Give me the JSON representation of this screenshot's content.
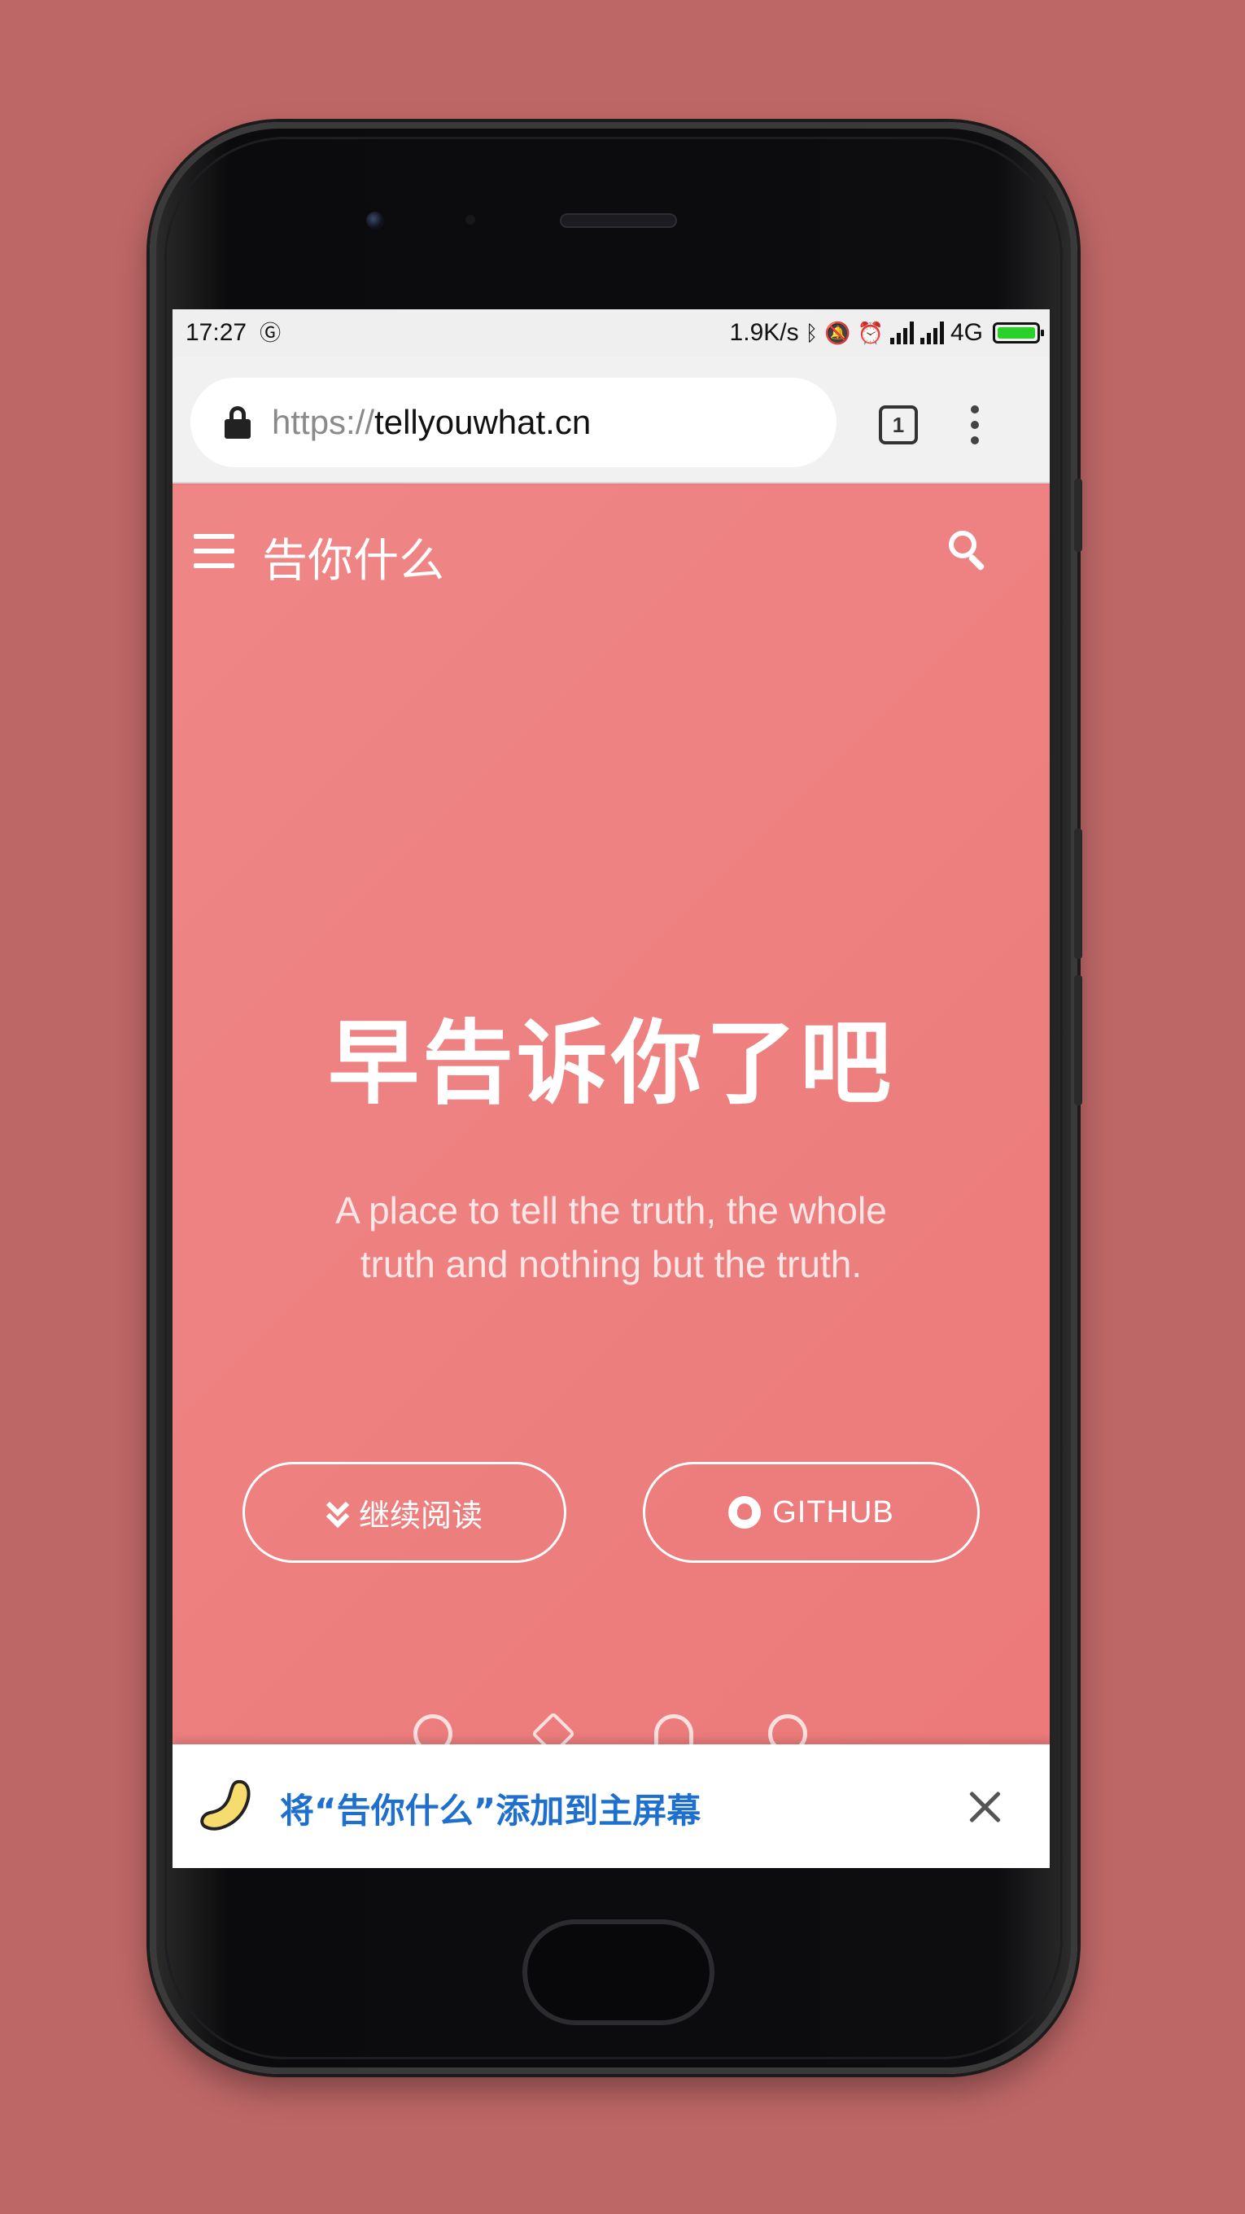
{
  "status_bar": {
    "time": "17:27",
    "net_speed": "1.9K/s",
    "network_type": "4G",
    "battery_level": 1.0,
    "icons": [
      "nfc-icon",
      "bluetooth-icon",
      "mute-bell-icon",
      "alarm-icon",
      "signal-icon",
      "signal-icon",
      "battery-icon"
    ]
  },
  "browser": {
    "url_scheme": "https://",
    "url_host": "tellyouwhat.cn",
    "tab_count": "1"
  },
  "site": {
    "brand": "告你什么",
    "hero_title": "早告诉你了吧",
    "hero_subtitle": "A place to tell the truth, the whole truth and nothing but the truth.",
    "buttons": {
      "read_more": "继续阅读",
      "github": "GITHUB"
    },
    "social_icons": [
      "github-icon",
      "email-icon",
      "qq-icon",
      "telegram-icon"
    ]
  },
  "install_banner": {
    "text": "将“告你什么”添加到主屏幕"
  },
  "colors": {
    "background": "#be6767",
    "page": "#ed7d7d",
    "banner_text": "#1f6fcf",
    "battery": "#2bd12b"
  }
}
